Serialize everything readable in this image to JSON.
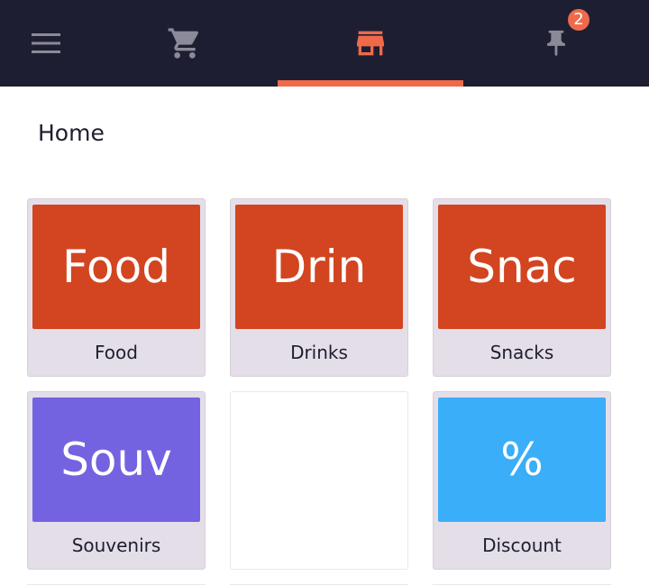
{
  "nav": {
    "items": [
      {
        "name": "menu",
        "icon": "hamburger-menu-icon"
      },
      {
        "name": "cart",
        "icon": "shopping-cart-icon"
      },
      {
        "name": "store",
        "icon": "storefront-icon",
        "active": true
      },
      {
        "name": "pin",
        "icon": "pushpin-icon"
      }
    ],
    "pin_badge": "2",
    "active_color": "#ef6a4a",
    "icon_color": "#8a8a98",
    "bar_color": "#1e1e32"
  },
  "page": {
    "title": "Home"
  },
  "tiles": [
    {
      "face": "Food",
      "label": "Food",
      "color": "#d24520"
    },
    {
      "face": "Drin",
      "label": "Drinks",
      "color": "#d24520"
    },
    {
      "face": "Snac",
      "label": "Snacks",
      "color": "#d24520"
    },
    {
      "face": "Souv",
      "label": "Souvenirs",
      "color": "#7363e0"
    },
    {
      "face": "",
      "label": "",
      "color": "",
      "empty": true
    },
    {
      "face": "%",
      "label": "Discount",
      "color": "#3aaef9"
    }
  ]
}
